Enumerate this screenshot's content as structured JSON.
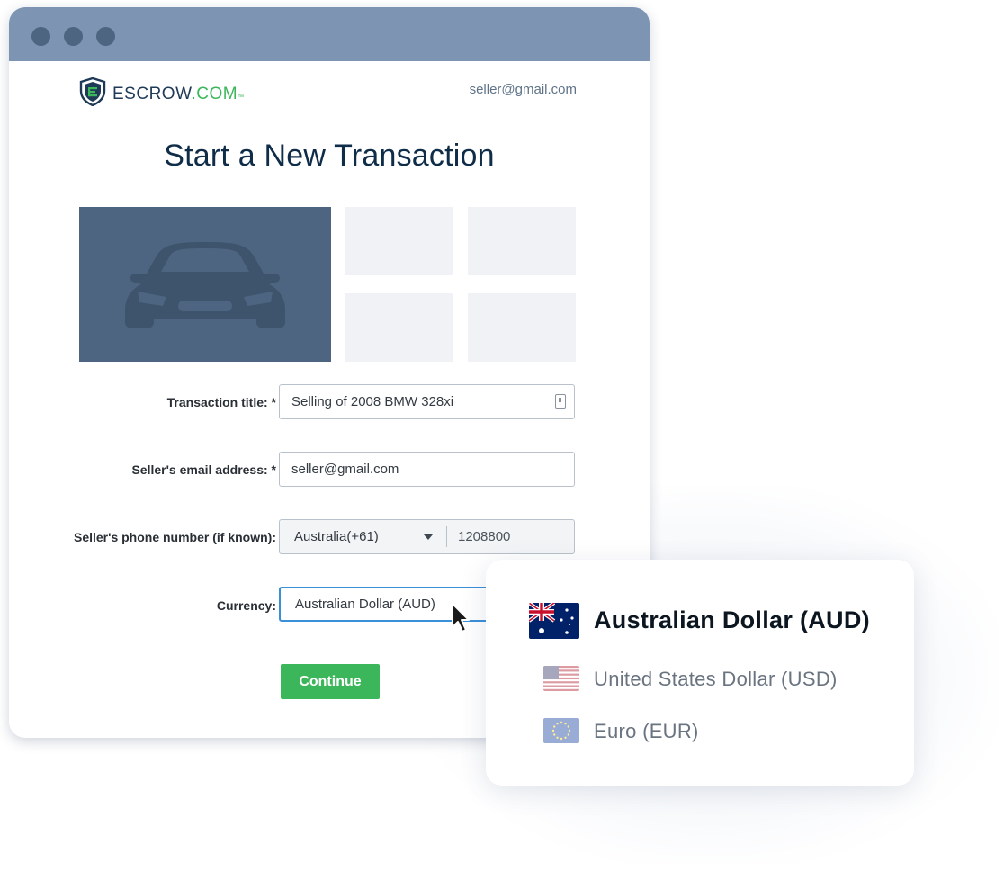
{
  "brand": {
    "name": "ESCROW",
    "suffix": ".COM",
    "tm": "™",
    "accent": "#3cb65a",
    "navy": "#1f3a57"
  },
  "header": {
    "user_email": "seller@gmail.com"
  },
  "page": {
    "title": "Start a New Transaction"
  },
  "form": {
    "transaction_title": {
      "label": "Transaction title: *",
      "value": "Selling of 2008 BMW 328xi"
    },
    "seller_email": {
      "label": "Seller's email address: *",
      "value": "seller@gmail.com"
    },
    "seller_phone": {
      "label": "Seller's phone number (if known):",
      "country": "Australia(+61)",
      "number": "1208800"
    },
    "currency": {
      "label": "Currency:",
      "value": "Australian Dollar (AUD)"
    },
    "continue_label": "Continue"
  },
  "currency_dropdown": {
    "options": [
      {
        "label": "Australian Dollar (AUD)",
        "flag": "australia-flag-icon",
        "selected": true
      },
      {
        "label": "United States Dollar (USD)",
        "flag": "us-flag-icon",
        "selected": false
      },
      {
        "label": "Euro (EUR)",
        "flag": "eu-flag-icon",
        "selected": false
      }
    ]
  },
  "icons": {
    "window_dots": "window-control-dots",
    "car": "car-icon",
    "contact_card": "contact-card-icon",
    "cursor": "mouse-pointer-icon"
  },
  "colors": {
    "titlebar": "#7d95b2",
    "photo_bg": "#4d6580",
    "focus_border": "#3a8fd9",
    "button": "#3cb65a"
  }
}
